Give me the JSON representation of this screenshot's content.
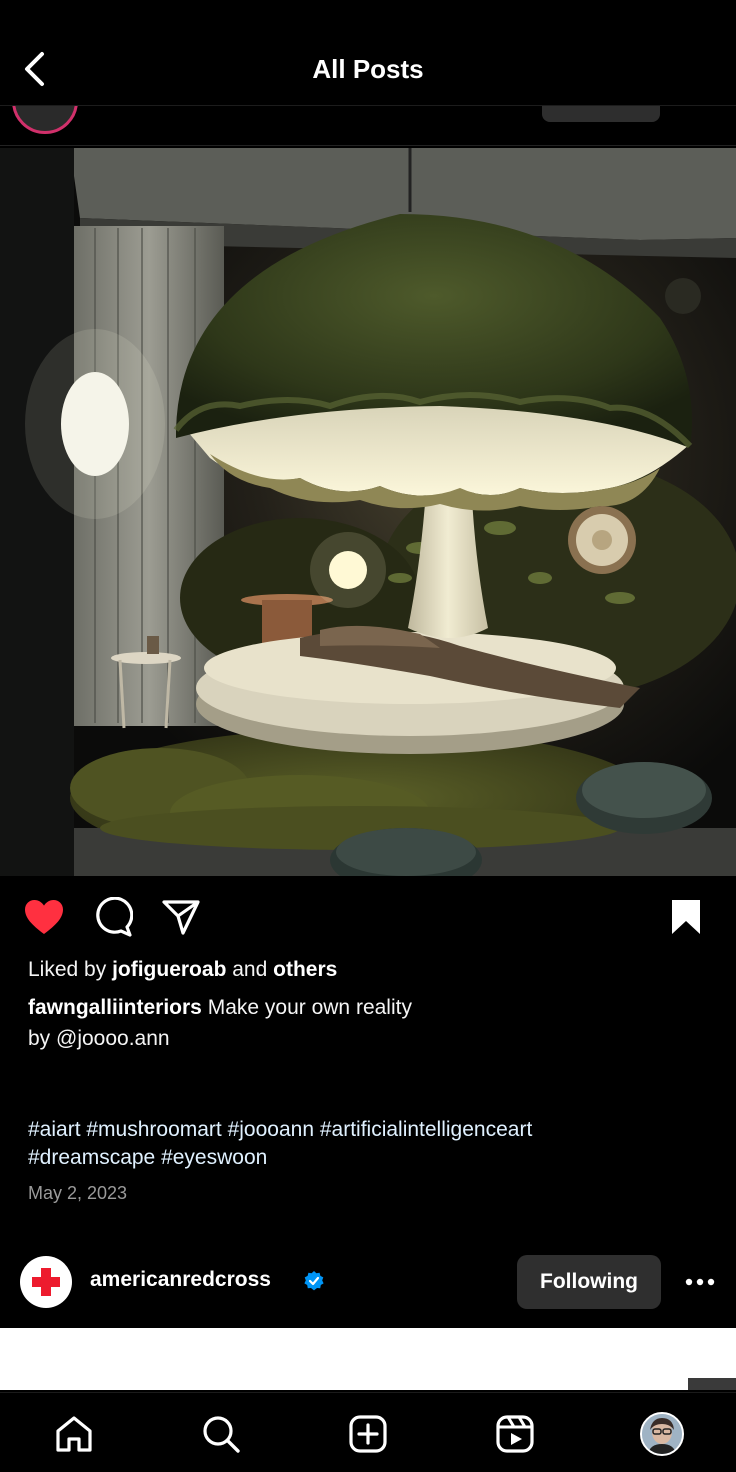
{
  "header": {
    "title": "All Posts"
  },
  "post": {
    "liked_prefix": "Liked by",
    "liked_user": "jofigueroab",
    "liked_and": "and",
    "liked_others": "others",
    "caption_user": "fawngalliinteriors",
    "caption_text": "Make your own reality",
    "caption_line2": "by @joooo.ann",
    "hashtags_line1": "#aiart #mushroomart #joooann #artificialintelligenceart",
    "hashtags_line2": "#dreamscape #eyeswoon",
    "date": "May 2, 2023",
    "liked": true,
    "saved": true
  },
  "next_post": {
    "username": "americanredcross",
    "verified": true,
    "follow_label": "Following"
  },
  "icons": {
    "back": "chevron-left-icon",
    "like": "heart-filled-icon",
    "comment": "comment-bubble-icon",
    "share": "paper-plane-icon",
    "save": "bookmark-filled-icon",
    "more": "more-horizontal-icon",
    "verified": "verified-badge-icon",
    "tabs": [
      "home-icon",
      "search-icon",
      "create-icon",
      "reels-icon",
      "profile-avatar"
    ]
  },
  "colors": {
    "like": "#ff3040",
    "verified": "#0095f6",
    "redcross": "#ed1b2e",
    "hashtag": "#e0f1ff"
  }
}
